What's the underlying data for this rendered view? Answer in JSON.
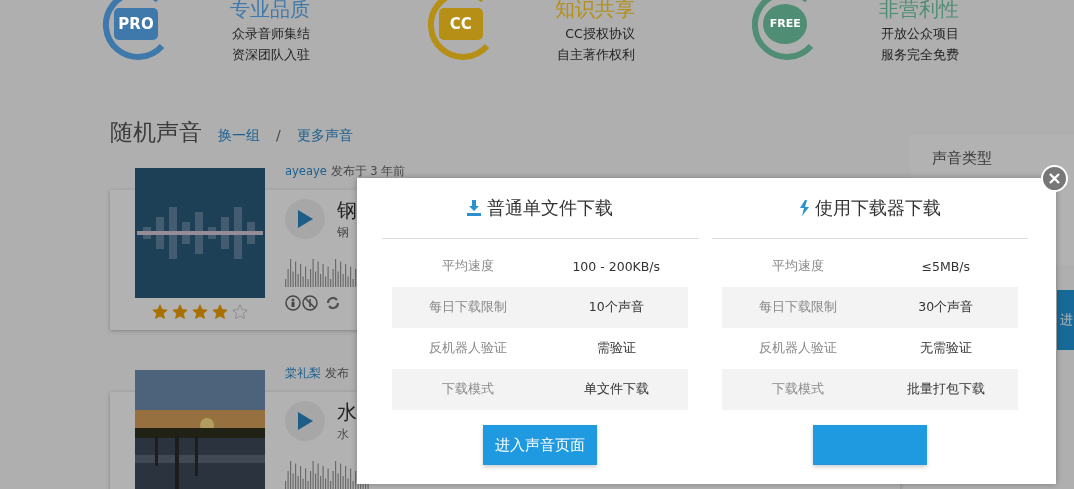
{
  "features": [
    {
      "badge": "PRO",
      "title": "专业品质",
      "lines": [
        "众录音师集结",
        "资深团队入驻"
      ],
      "color": "#3f78aa"
    },
    {
      "badge": "CC",
      "title": "知识共享",
      "lines": [
        "CC授权协议",
        "自主著作权利"
      ],
      "color": "#b58f16"
    },
    {
      "badge": "FREE",
      "title": "非营利性",
      "lines": [
        "开放公众项目",
        "服务完全免费"
      ],
      "color": "#4f8e74"
    }
  ],
  "section": {
    "title": "随机声音",
    "links": [
      "换一组",
      "更多声音"
    ],
    "separator": "/"
  },
  "sounds": [
    {
      "author": "ayeaye",
      "posted": "发布于 3 年前",
      "title": "钢",
      "subtitle": "钢",
      "stars": 4
    },
    {
      "author": "棠礼梨",
      "posted": "发布",
      "title": "水",
      "subtitle": "水"
    }
  ],
  "sidebar": {
    "title": "声音类型",
    "button": "进"
  },
  "modal": {
    "closable": true,
    "columns": [
      {
        "kind": "single",
        "title": "普通单文件下载",
        "rows": [
          {
            "label": "平均速度",
            "value": "100 - 200KB/s"
          },
          {
            "label": "每日下载限制",
            "value": "10个声音"
          },
          {
            "label": "反机器人验证",
            "value": "需验证"
          },
          {
            "label": "下载模式",
            "value": "单文件下载"
          }
        ],
        "button_label": "进入声音页面"
      },
      {
        "kind": "downloader",
        "title": "使用下载器下载",
        "rows": [
          {
            "label": "平均速度",
            "value": "≤5MB/s"
          },
          {
            "label": "每日下载限制",
            "value": "30个声音"
          },
          {
            "label": "反机器人验证",
            "value": "无需验证"
          },
          {
            "label": "下载模式",
            "value": "批量打包下载"
          }
        ]
      }
    ]
  }
}
